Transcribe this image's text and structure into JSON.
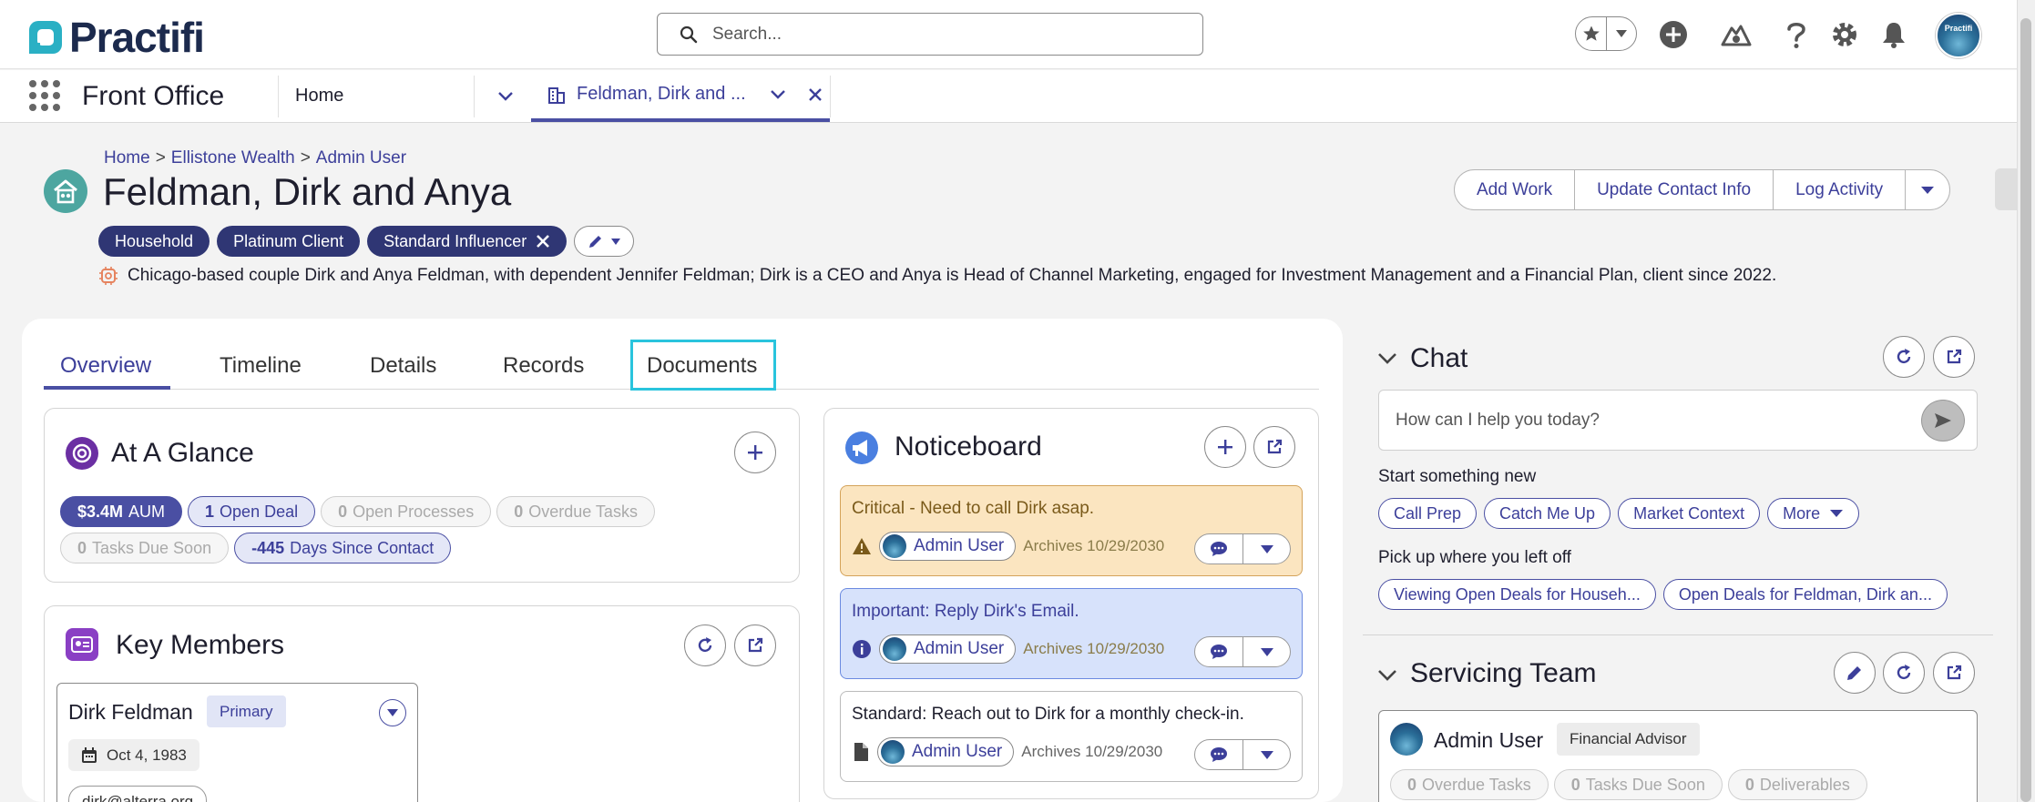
{
  "header": {
    "brand": "Practifi",
    "search_placeholder": "Search...",
    "avatar_label": "Practifi"
  },
  "nav": {
    "app_name": "Front Office",
    "home_tab": "Home",
    "record_tab": "Feldman, Dirk and ..."
  },
  "record": {
    "breadcrumb": [
      "Home",
      "Ellistone Wealth",
      "Admin User"
    ],
    "breadcrumb_sep": ">",
    "title": "Feldman, Dirk and Anya",
    "tags": [
      "Household",
      "Platinum Client",
      "Standard Influencer"
    ],
    "summary": "Chicago-based couple Dirk and Anya Feldman, with dependent Jennifer Feldman; Dirk is a CEO and Anya is Head of Channel Marketing, engaged for Investment Management and a Financial Plan, client since 2022.",
    "actions": [
      "Add Work",
      "Update Contact Info",
      "Log Activity"
    ]
  },
  "tabs": [
    "Overview",
    "Timeline",
    "Details",
    "Records",
    "Documents"
  ],
  "glance": {
    "title": "At A Glance",
    "chips": [
      {
        "value": "$3.4M",
        "label": "AUM",
        "style": "dark"
      },
      {
        "value": "1",
        "label": "Open Deal",
        "style": "light"
      },
      {
        "value": "0",
        "label": "Open Processes",
        "style": "muted"
      },
      {
        "value": "0",
        "label": "Overdue Tasks",
        "style": "muted"
      },
      {
        "value": "0",
        "label": "Tasks Due Soon",
        "style": "muted"
      },
      {
        "value": "-445",
        "label": "Days Since Contact",
        "style": "light"
      }
    ]
  },
  "members": {
    "title": "Key Members",
    "card": {
      "name": "Dirk Feldman",
      "badge": "Primary",
      "dob": "Oct 4, 1983",
      "email": "dirk@alterra.org"
    }
  },
  "noticeboard": {
    "title": "Noticeboard",
    "items": [
      {
        "text": "Critical - Need to call Dirk asap.",
        "user": "Admin User",
        "archive": "Archives 10/29/2030",
        "level": "critical"
      },
      {
        "text": "Important: Reply Dirk's Email.",
        "user": "Admin User",
        "archive": "Archives 10/29/2030",
        "level": "important"
      },
      {
        "text": "Standard: Reach out to Dirk for a monthly check-in.",
        "user": "Admin User",
        "archive": "Archives 10/29/2030",
        "level": "standard"
      }
    ]
  },
  "chat": {
    "title": "Chat",
    "placeholder": "How can I help you today?",
    "start_label": "Start something new",
    "start_pills": [
      "Call Prep",
      "Catch Me Up",
      "Market Context",
      "More"
    ],
    "resume_label": "Pick up where you left off",
    "resume_pills": [
      "Viewing Open Deals for Househ...",
      "Open Deals for Feldman, Dirk an..."
    ]
  },
  "team": {
    "title": "Servicing Team",
    "member": {
      "name": "Admin User",
      "role": "Financial Advisor"
    },
    "chips": [
      {
        "value": "0",
        "label": "Overdue Tasks"
      },
      {
        "value": "0",
        "label": "Tasks Due Soon"
      },
      {
        "value": "0",
        "label": "Deliverables"
      }
    ]
  },
  "colors": {
    "accent": "#4a4fa3",
    "tag_bg": "#2f3674",
    "critical_bg": "#fbe5c0",
    "important_bg": "#d7e2fb",
    "highlight": "#29c4dd"
  }
}
